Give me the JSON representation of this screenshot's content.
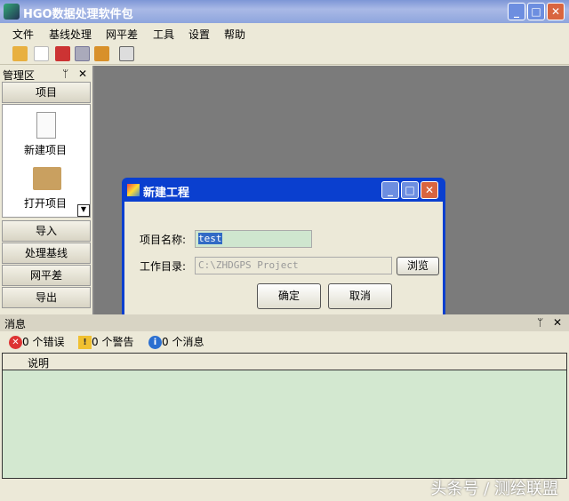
{
  "app": {
    "title": "HGO数据处理软件包"
  },
  "menu": [
    "文件",
    "基线处理",
    "网平差",
    "工具",
    "设置",
    "帮助"
  ],
  "toolbar_icons": [
    "open-folder-icon",
    "new-file-icon",
    "import-icon",
    "save-icon",
    "export-icon",
    "window-icon"
  ],
  "left_panel": {
    "title": "管理区",
    "pin": "ᛘ",
    "close": "✕",
    "project_button": "项目",
    "items": [
      {
        "label": "新建项目",
        "icon": "new-file-icon"
      },
      {
        "label": "打开项目",
        "icon": "folder-icon"
      }
    ],
    "sections": [
      "导入",
      "处理基线",
      "网平差",
      "导出"
    ]
  },
  "dialog": {
    "title": "新建工程",
    "name_label": "项目名称:",
    "name_value": "test",
    "dir_label": "工作目录:",
    "dir_value": "C:\\ZHDGPS Project",
    "browse": "浏览",
    "ok": "确定",
    "cancel": "取消"
  },
  "messages": {
    "title": "消息",
    "pin": "ᛘ",
    "close": "✕",
    "errors": "0 个错误",
    "warnings": "0 个警告",
    "infos": "0 个消息",
    "column": "说明"
  },
  "watermark": "头条号 / 测绘联盟",
  "colors": {
    "title_bar": "#8ea5dd",
    "dialog_border": "#0a3fcf",
    "list_bg": "#d3e8d0",
    "workspace": "#7b7b7b"
  }
}
